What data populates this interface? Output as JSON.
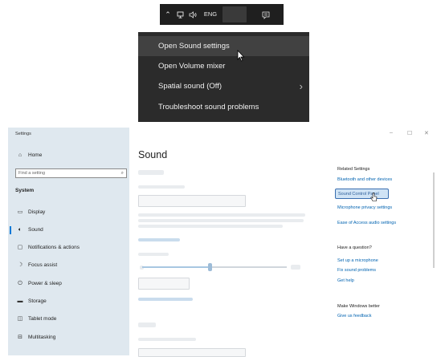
{
  "taskbar": {
    "chevron_icon": "chevron-up-icon",
    "network_icon": "network-icon",
    "volume_icon": "volume-icon",
    "language": "ENG",
    "notifications_icon": "action-center-icon"
  },
  "context_menu": {
    "items": [
      {
        "label": "Open Sound settings",
        "highlighted": true
      },
      {
        "label": "Open Volume mixer"
      },
      {
        "label": "Spatial sound (Off)",
        "has_submenu": true
      },
      {
        "label": "Troubleshoot sound problems"
      }
    ],
    "submenu_icon": "chevron-right-icon"
  },
  "settings": {
    "app_title": "Settings",
    "search_placeholder": "Find a setting",
    "home_label": "Home",
    "section_label": "System",
    "nav_items": [
      {
        "label": "Display",
        "icon": "display-icon"
      },
      {
        "label": "Sound",
        "icon": "speaker-icon",
        "active": true
      },
      {
        "label": "Notifications & actions",
        "icon": "notifications-icon"
      },
      {
        "label": "Focus assist",
        "icon": "moon-icon"
      },
      {
        "label": "Power & sleep",
        "icon": "power-icon"
      },
      {
        "label": "Storage",
        "icon": "storage-icon"
      },
      {
        "label": "Tablet mode",
        "icon": "tablet-icon"
      },
      {
        "label": "Multitasking",
        "icon": "multitasking-icon"
      }
    ],
    "page_title": "Sound",
    "window_controls": {
      "minimize": "–",
      "maximize": "☐",
      "close": "✕"
    },
    "related": {
      "heading": "Related Settings",
      "links": [
        "Bluetooth and other devices",
        "Sound Control Panel",
        "Microphone privacy settings",
        "Ease of Access audio settings"
      ]
    },
    "question": {
      "heading": "Have a question?",
      "links": [
        "Set up a microphone",
        "Fix sound problems",
        "Get help"
      ]
    },
    "better": {
      "heading": "Make Windows better",
      "links": [
        "Give us feedback"
      ]
    },
    "accent_color": "#0078d7"
  }
}
